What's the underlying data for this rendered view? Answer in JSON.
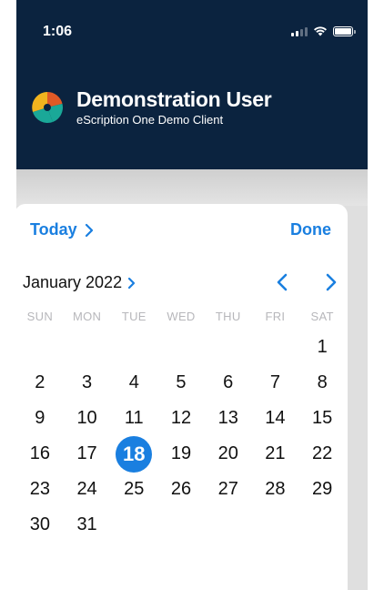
{
  "status_bar": {
    "time": "1:06"
  },
  "header": {
    "user_name": "Demonstration User",
    "client_name": "eScription One Demo Client"
  },
  "picker": {
    "today_label": "Today",
    "done_label": "Done",
    "month_label": "January 2022",
    "weekdays": [
      "SUN",
      "MON",
      "TUE",
      "WED",
      "THU",
      "FRI",
      "SAT"
    ],
    "days": [
      "",
      "",
      "",
      "",
      "",
      "",
      "1",
      "2",
      "3",
      "4",
      "5",
      "6",
      "7",
      "8",
      "9",
      "10",
      "11",
      "12",
      "13",
      "14",
      "15",
      "16",
      "17",
      "18",
      "19",
      "20",
      "21",
      "22",
      "23",
      "24",
      "25",
      "26",
      "27",
      "28",
      "29",
      "30",
      "31",
      "",
      "",
      "",
      "",
      ""
    ],
    "selected_day": "18"
  },
  "colors": {
    "header_bg": "#0b233f",
    "accent": "#1a7fe0",
    "weekday_text": "#b7b7bb"
  },
  "icons": {
    "logo": "app-logo",
    "today_chevron": "chevron-right-icon",
    "month_chevron": "chevron-right-icon",
    "prev": "chevron-left-icon",
    "next": "chevron-right-icon"
  }
}
